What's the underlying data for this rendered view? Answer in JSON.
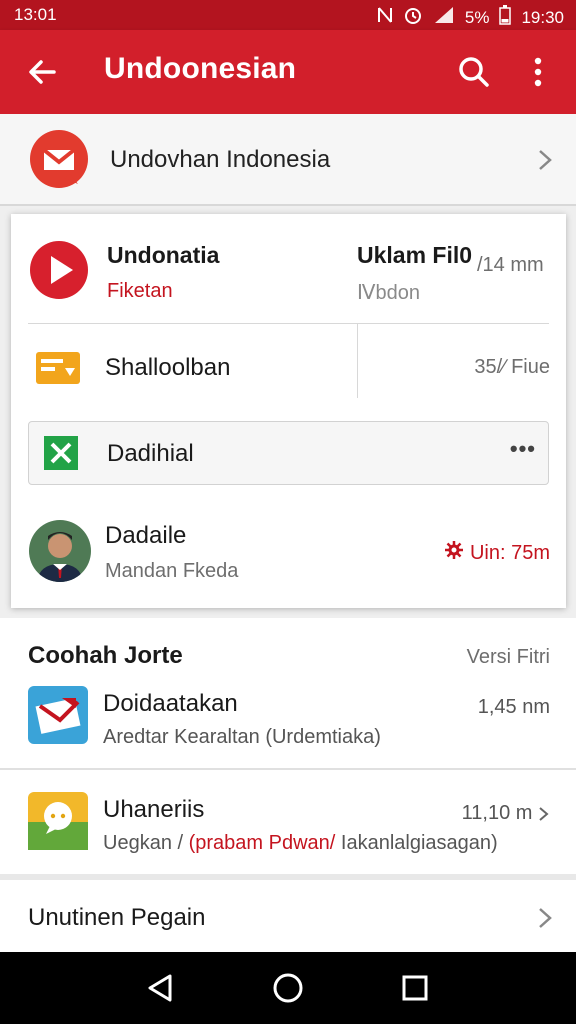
{
  "status_bar": {
    "time_left": "13:01",
    "battery": "5%",
    "time_right": "19:30"
  },
  "app_bar": {
    "title": "Undoonesian"
  },
  "top_row": {
    "label": "Undovhan Indonesia"
  },
  "panel": {
    "row1": {
      "title": "Undonatia",
      "subtitle": "Fiketan",
      "right_title": "Uklam Fil0",
      "right_suffix": "/14 mm",
      "right_subtitle": "Ⅳbdon"
    },
    "row2": {
      "title": "Shalloolban",
      "right": "35/∕ Fiue"
    },
    "row3": {
      "title": "Dadihial",
      "dots": "•••"
    },
    "row4": {
      "title": "Dadaile",
      "subtitle": "Mandan Fkeda",
      "right": "Uin: 75m"
    }
  },
  "section": {
    "header": "Coohah Jorte",
    "header_right": "Versi Fitri",
    "items": [
      {
        "title": "Doidaatakan",
        "subtitle": "Aredtar Kearaltan (Urdemtiaka)",
        "right": "1,45 nm"
      },
      {
        "title": "Uhaneriis",
        "subtitle_a": "Uegkan / ",
        "subtitle_red": "(prabam Pdwan/",
        "subtitle_b": " Iakanlalgiasagan)",
        "right": "11,10 m"
      }
    ],
    "footer": "Unutinen Pegain"
  },
  "colors": {
    "accent": "#d21f2b",
    "status": "#b3141f",
    "red_text": "#c4141f"
  }
}
